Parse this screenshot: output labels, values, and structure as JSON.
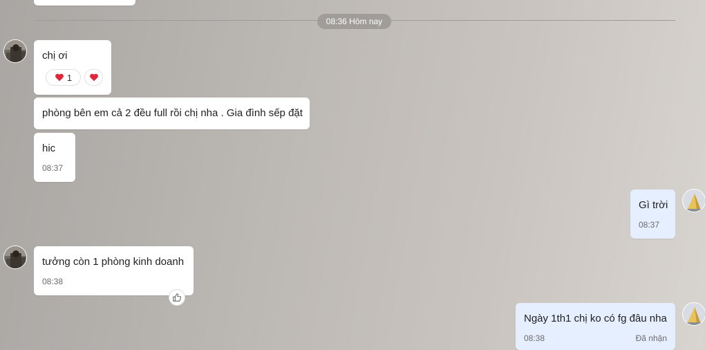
{
  "divider": {
    "label": "08:36 Hôm nay"
  },
  "messages": [
    {
      "text": "chị ơi",
      "reaction_count": "1"
    },
    {
      "text": "phòng bên em cả 2 đều full rồi chị nha . Gia đình sếp đặt"
    },
    {
      "text": "hic",
      "time": "08:37"
    },
    {
      "text": "Gì trời",
      "time": "08:37"
    },
    {
      "text": "tưởng còn 1 phòng kinh doanh",
      "time": "08:38"
    },
    {
      "text": "Ngày 1th1 chị ko có fg đâu nha",
      "time": "08:38",
      "status": "Đã nhận"
    }
  ],
  "icons": {
    "reaction": "heart-icon",
    "like": "thumbs-up-icon"
  },
  "colors": {
    "incoming_bubble": "#ffffff",
    "outgoing_bubble": "#e5efff",
    "heart": "#e0263a"
  }
}
